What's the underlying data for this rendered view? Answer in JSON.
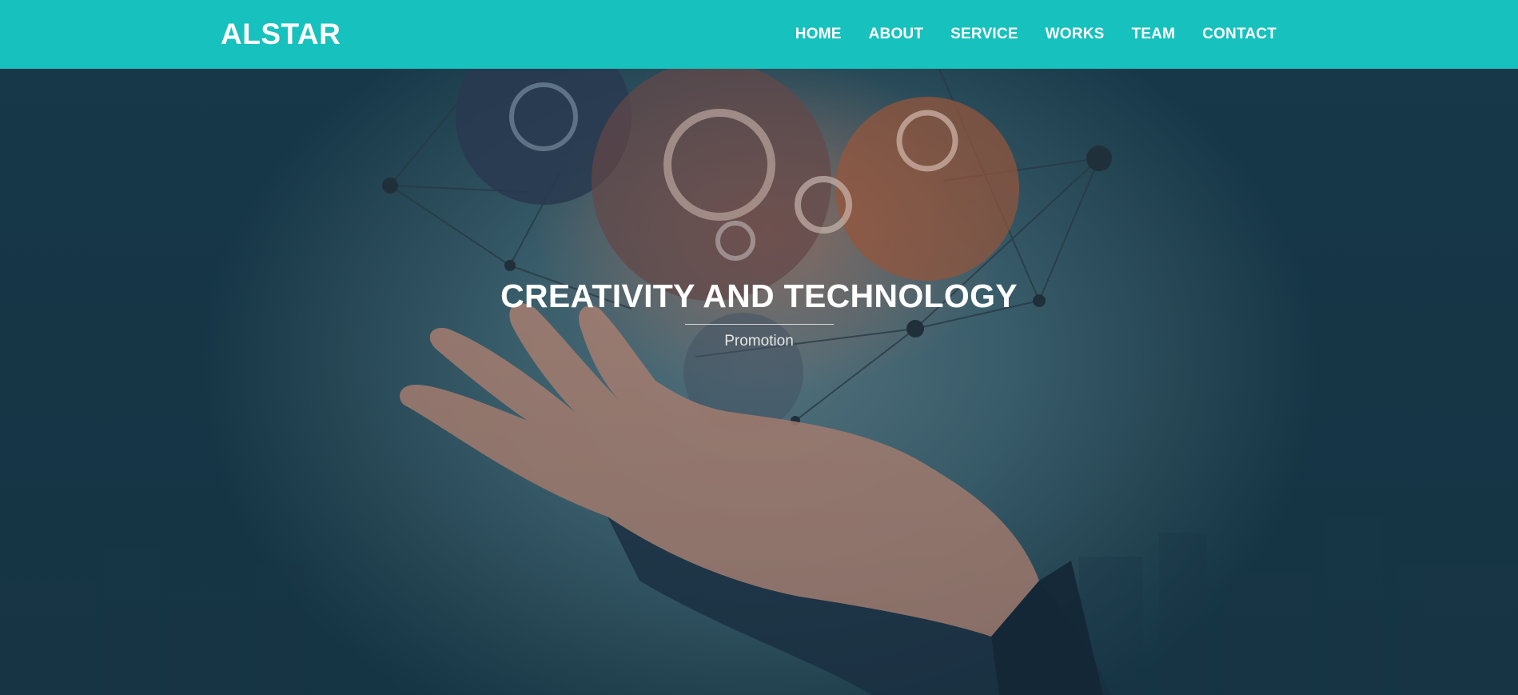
{
  "brand": {
    "name": "ALSTAR",
    "bar_color": "#17c1bd"
  },
  "nav": {
    "items": [
      {
        "label": "HOME"
      },
      {
        "label": "ABOUT"
      },
      {
        "label": "SERVICE"
      },
      {
        "label": "WORKS"
      },
      {
        "label": "TEAM"
      },
      {
        "label": "CONTACT"
      }
    ]
  },
  "hero": {
    "title": "CREATIVITY AND TECHNOLOGY",
    "subtitle": "Promotion",
    "background_image": "hand-holding-gears-network-icon"
  }
}
